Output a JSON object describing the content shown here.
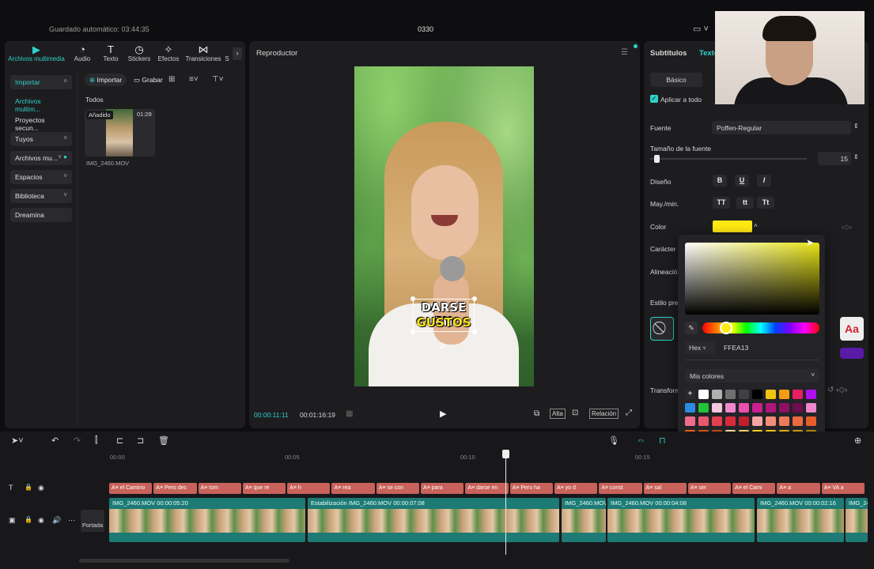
{
  "app": {
    "autosave": "Guardado automático: 03:44:35",
    "project_name": "0330"
  },
  "media_panel": {
    "tabs": [
      {
        "label": "Archivos multimedia",
        "icon": "media-icon",
        "active": true
      },
      {
        "label": "Audio",
        "icon": "audio-icon"
      },
      {
        "label": "Texto",
        "icon": "text-icon"
      },
      {
        "label": "Stickers",
        "icon": "sticker-icon"
      },
      {
        "label": "Efectos",
        "icon": "effects-icon"
      },
      {
        "label": "Transiciones",
        "icon": "transitions-icon"
      },
      {
        "label": "S",
        "icon": ""
      }
    ],
    "sidebar": [
      {
        "label": "Importar",
        "active": true
      },
      {
        "label": "Archivos multim...",
        "active": true
      },
      {
        "label": "Proyectos secun..."
      },
      {
        "label": "Tuyos"
      },
      {
        "label": "Archivos mu..."
      },
      {
        "label": "Espacios"
      },
      {
        "label": "Biblioteca"
      },
      {
        "label": "Dreamina"
      }
    ],
    "import_button": "Importar",
    "record_button": "Grabar",
    "section_title": "Todos",
    "thumb": {
      "badge": "Añadido",
      "duration": "01:28",
      "filename": "IMG_2460.MOV"
    }
  },
  "player": {
    "title": "Reproductor",
    "current_time": "00:00:11:11",
    "total_time": "00:01:16:19",
    "caption_line1": "DARSE EN",
    "caption_line2": "GUSTOS",
    "quality_label": "Alta",
    "ratio_label": "Relación"
  },
  "props": {
    "tabs": [
      "Subtítulos",
      "Texto"
    ],
    "basic_tab": "Básico",
    "apply_all": "Aplicar a todo",
    "font_label": "Fuente",
    "font_value": "Poffen-Regular",
    "size_label": "Tamaño de la fuente",
    "size_value": "15",
    "design_label": "Diseño",
    "case_label": "May./min.",
    "case_options": [
      "TT",
      "tt",
      "Tt"
    ],
    "color_label": "Color",
    "color_value": "#FFEA13",
    "char_label": "Carácter",
    "align_label": "Alineació",
    "style_label": "Estilo pre",
    "transform_label": "Transform",
    "style_sample": "Aa"
  },
  "color_picker": {
    "format": "Hex",
    "hex_value": "FFEA13",
    "my_colors": "Mis colores",
    "swatches": [
      [
        "#ffffff",
        "#ffffff",
        "#b0b0b0",
        "#707070",
        "#404040",
        "#000000",
        "#f1c40f",
        "#f39c12",
        "#e91e63",
        "#b010f0"
      ],
      [
        "#2b8be0",
        "#22c33a",
        "#f3c6e0",
        "#ee88cc",
        "#e84fae",
        "#cc1f8e",
        "#b0157a",
        "#8e1062",
        "#6e0d4d",
        "#ee88cc"
      ],
      [
        "#ee6b8a",
        "#e8576b",
        "#e23f4f",
        "#d92a3a",
        "#c21f2f",
        "#f5a3a3",
        "#f28d7a",
        "#ef7a5a",
        "#ec6a40",
        "#e95d2a"
      ],
      [
        "#e86010",
        "#d4560f",
        "#c04a0d",
        "#f3d9a0",
        "#f2d06a",
        "#f5d21d",
        "#f1c40f",
        "#e0b010",
        "#c99a10",
        "#b08510"
      ],
      [
        "#f2f5a0",
        "#f2f570",
        "#f2f540",
        "#d9e82a",
        "#b5d62a",
        "#8ecb2a",
        "#6ac22a",
        "#4fbb2a",
        "#38b42a",
        "#22ad2a"
      ]
    ]
  },
  "timeline": {
    "ruler": [
      "00:00",
      "00:05",
      "00:10",
      "00:15"
    ],
    "text_clips": [
      "el Camino",
      "Pero dec",
      "tom",
      "que re",
      "h",
      "rea",
      "se con",
      "para",
      "darse en",
      "Pero ha",
      "yo d",
      "const",
      "sal",
      "ser",
      "el Cami",
      "a",
      "VA a"
    ],
    "video_clips": [
      {
        "label": "IMG_2460.MOV  00:00:05:20"
      },
      {
        "label": "Estabilización   IMG_2460.MOV  00:00:07:08"
      },
      {
        "label": "IMG_2460.MOV"
      },
      {
        "label": "IMG_2460.MOV  00:00:04:08"
      },
      {
        "label": "IMG_2460.MOV  00:00:02:16"
      },
      {
        "label": "IMG_24"
      }
    ],
    "cover_label": "Portada"
  },
  "colors": {
    "accent": "#2ed1c8",
    "caption_yellow": "#FFEA13"
  }
}
